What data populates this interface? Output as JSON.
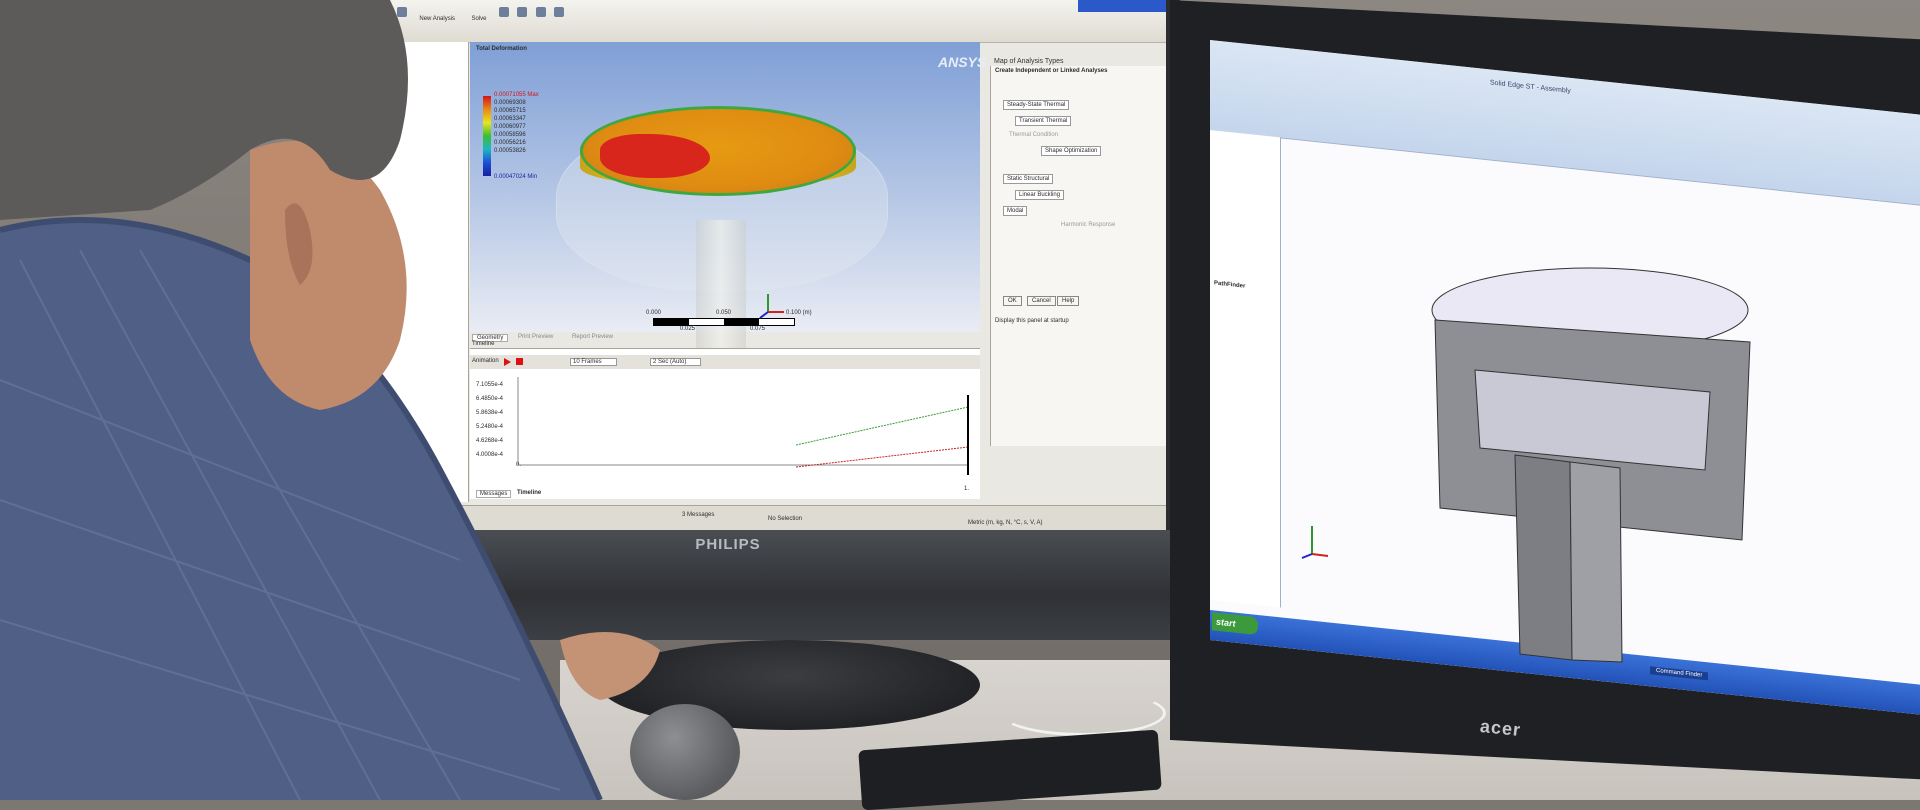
{
  "left_monitor": {
    "brand": "PHILIPS",
    "app": {
      "toolbar_items": [
        "New Analysis",
        "Solve"
      ],
      "result": {
        "title": "Total Deformation",
        "legend_max": "0.00071055 Max",
        "legend_min": "0.00047024 Min",
        "legend_values": [
          "0.00069308",
          "0.00065715",
          "0.00063347",
          "0.00060977",
          "0.00058596",
          "0.00056216",
          "0.00053826"
        ]
      },
      "logo": "ANSYS",
      "wizard": {
        "header": "Map of Analysis Types",
        "title": "Create Independent or Linked Analyses",
        "nodes": [
          "Steady-State Thermal",
          "Transient Thermal",
          "Thermal Condition",
          "Shape Optimization",
          "Static Structural",
          "Linear Buckling",
          "Modal",
          "Harmonic Response"
        ],
        "buttons": [
          "OK",
          "Cancel",
          "Help"
        ],
        "checkbox": "Display this panel at startup"
      },
      "tabs": [
        "Geometry",
        "Print Preview",
        "Report Preview"
      ],
      "graph": {
        "panel_title": "Timeline",
        "animation_label": "Animation",
        "frames": "10 Frames",
        "duration": "2 Sec (Auto)",
        "y_ticks": [
          "7.1055e-4",
          "6.4850e-4",
          "5.8638e-4",
          "5.2480e-4",
          "4.6268e-4",
          "4.0008e-4"
        ],
        "x_start": "0.",
        "x_end": "1."
      },
      "bottom_tabs": [
        "Messages",
        "Timeline"
      ],
      "status": {
        "messages": "3 Messages",
        "selection": "No Selection",
        "units": "Metric (m, kg, N, °C, s, V, A)"
      },
      "scale": [
        "0.000",
        "0.050",
        "0.100 (m)",
        "0.025",
        "0.075"
      ]
    }
  },
  "right_monitor": {
    "brand": "acer",
    "app": {
      "title": "Solid Edge ST - Assembly",
      "panel_title": "PathFinder",
      "command_finder": "Command Finder",
      "start_label": "start"
    }
  }
}
